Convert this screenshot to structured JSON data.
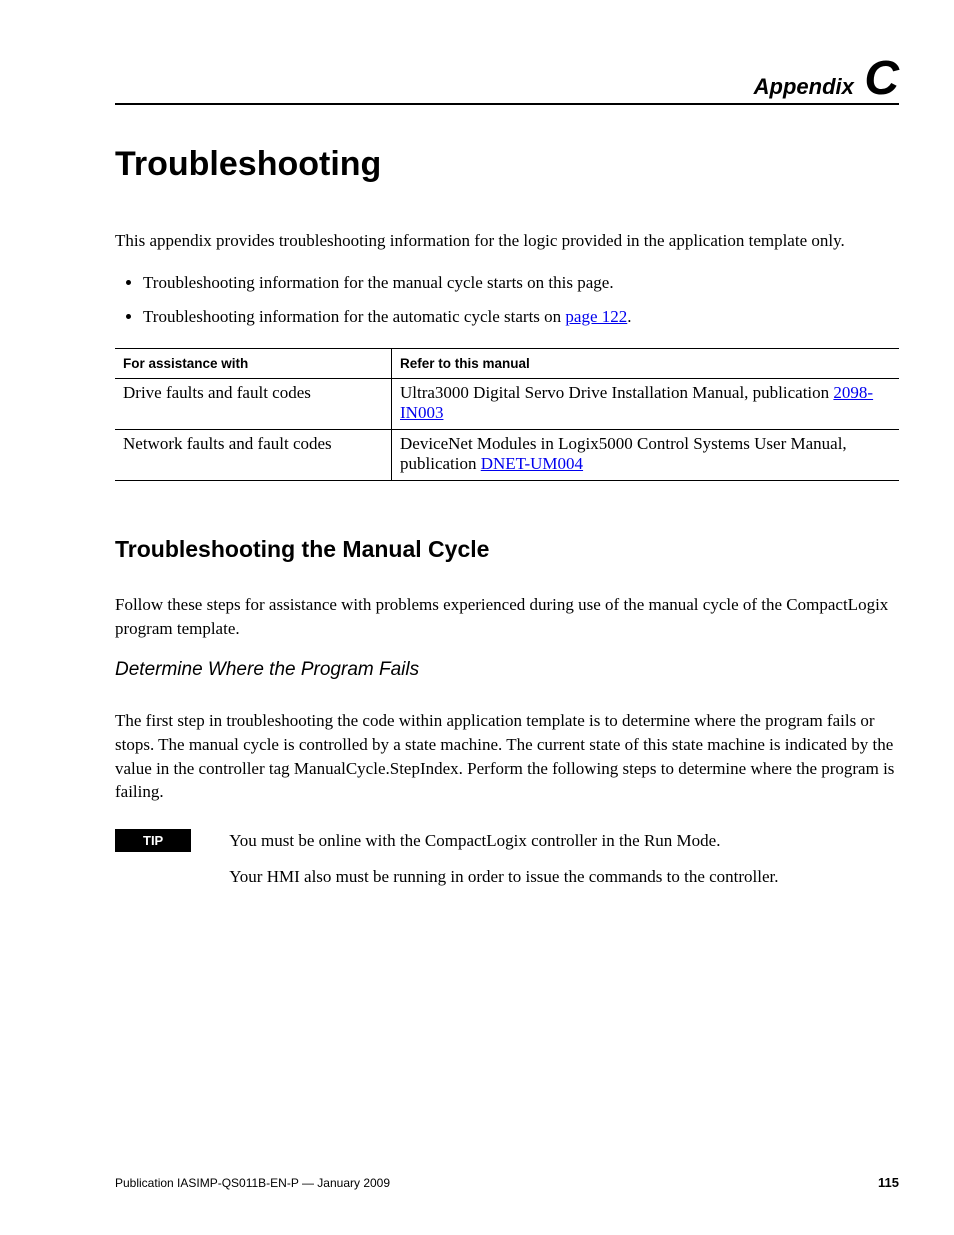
{
  "header": {
    "prefix": "Appendix",
    "letter": "C"
  },
  "title": "Troubleshooting",
  "intro": "This appendix provides troubleshooting information for the logic provided in the application template only.",
  "bullets": [
    {
      "text": "Troubleshooting information for the manual cycle starts on this page."
    },
    {
      "text_pre": "Troubleshooting information for the automatic cycle starts on ",
      "link": "page 122",
      "text_post": "."
    }
  ],
  "table": {
    "headers": [
      "For assistance with",
      "Refer to this manual"
    ],
    "rows": [
      {
        "c1": "Drive faults and fault codes",
        "c2_pre": "Ultra3000 Digital Servo Drive Installation Manual, publication ",
        "c2_link": "2098-IN003"
      },
      {
        "c1": "Network faults and fault codes",
        "c2_pre": "DeviceNet Modules in Logix5000 Control Systems User Manual, publication ",
        "c2_link": "DNET-UM004"
      }
    ]
  },
  "section": {
    "title": "Troubleshooting the Manual Cycle",
    "intro": "Follow these steps for assistance with problems experienced during use of the manual cycle of the CompactLogix program template.",
    "sub_title": "Determine Where the Program Fails",
    "body": "The first step in troubleshooting the code within application template is to determine where the program fails or stops. The manual cycle is controlled by a state machine. The current state of this state machine is indicated by the value in the controller tag ManualCycle.StepIndex. Perform the following steps to determine where the program is failing."
  },
  "tip": {
    "label": "TIP",
    "line1": "You must be online with the CompactLogix controller in the Run Mode.",
    "line2": "Your HMI also must be running in order to issue the commands to the controller."
  },
  "footer": {
    "publication": "Publication IASIMP-QS011B-EN-P — January 2009",
    "page_number": "115"
  }
}
